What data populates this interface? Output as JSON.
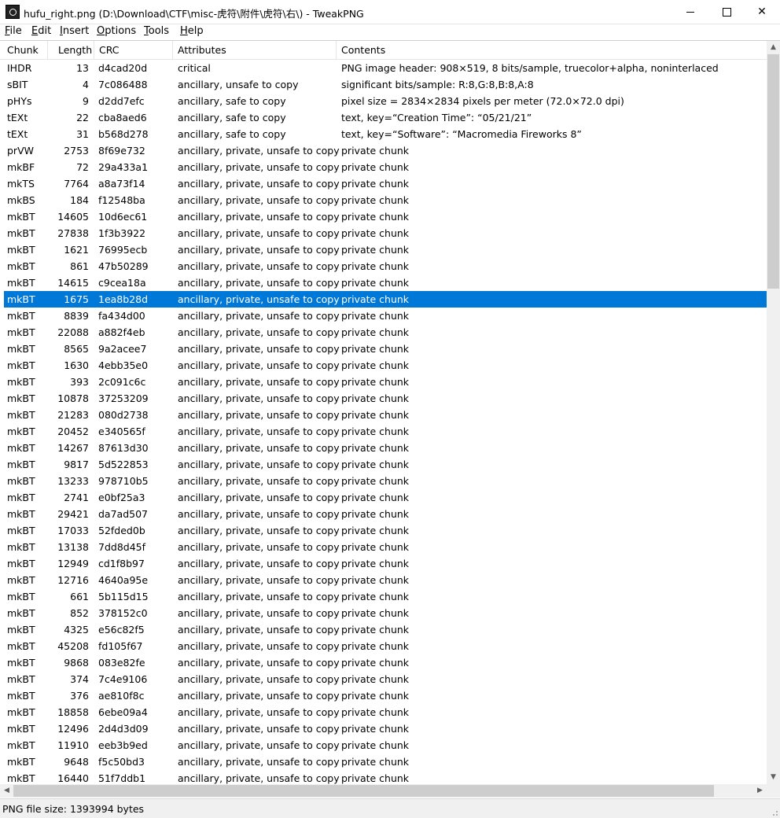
{
  "window": {
    "title": "hufu_right.png (D:\\Download\\CTF\\misc-虎符\\附件\\虎符\\右\\) - TweakPNG"
  },
  "menu": [
    {
      "key": "F",
      "rest": "ile"
    },
    {
      "key": "E",
      "rest": "dit"
    },
    {
      "key": "I",
      "rest": "nsert"
    },
    {
      "key": "O",
      "rest": "ptions"
    },
    {
      "key": "T",
      "rest": "ools"
    },
    {
      "key": "H",
      "rest": "elp"
    }
  ],
  "columns": [
    "Chunk",
    "Length",
    "CRC",
    "Attributes",
    "Contents"
  ],
  "rows": [
    {
      "chunk": "IHDR",
      "length": "13",
      "crc": "d4cad20d",
      "attributes": "critical",
      "contents": "PNG image header: 908×519, 8 bits/sample, truecolor+alpha, noninterlaced"
    },
    {
      "chunk": "sBIT",
      "length": "4",
      "crc": "7c086488",
      "attributes": "ancillary, unsafe to copy",
      "contents": "significant bits/sample: R:8,G:8,B:8,A:8"
    },
    {
      "chunk": "pHYs",
      "length": "9",
      "crc": "d2dd7efc",
      "attributes": "ancillary, safe to copy",
      "contents": "pixel size = 2834×2834 pixels per meter (72.0×72.0 dpi)"
    },
    {
      "chunk": "tEXt",
      "length": "22",
      "crc": "cba8aed6",
      "attributes": "ancillary, safe to copy",
      "contents": "text, key=“Creation Time”: “05/21/21”"
    },
    {
      "chunk": "tEXt",
      "length": "31",
      "crc": "b568d278",
      "attributes": "ancillary, safe to copy",
      "contents": "text, key=“Software”: “Macromedia Fireworks 8”"
    },
    {
      "chunk": "prVW",
      "length": "2753",
      "crc": "8f69e732",
      "attributes": "ancillary, private, unsafe to copy",
      "contents": "private chunk"
    },
    {
      "chunk": "mkBF",
      "length": "72",
      "crc": "29a433a1",
      "attributes": "ancillary, private, unsafe to copy",
      "contents": "private chunk"
    },
    {
      "chunk": "mkTS",
      "length": "7764",
      "crc": "a8a73f14",
      "attributes": "ancillary, private, unsafe to copy",
      "contents": "private chunk"
    },
    {
      "chunk": "mkBS",
      "length": "184",
      "crc": "f12548ba",
      "attributes": "ancillary, private, unsafe to copy",
      "contents": "private chunk"
    },
    {
      "chunk": "mkBT",
      "length": "14605",
      "crc": "10d6ec61",
      "attributes": "ancillary, private, unsafe to copy",
      "contents": "private chunk"
    },
    {
      "chunk": "mkBT",
      "length": "27838",
      "crc": "1f3b3922",
      "attributes": "ancillary, private, unsafe to copy",
      "contents": "private chunk"
    },
    {
      "chunk": "mkBT",
      "length": "1621",
      "crc": "76995ecb",
      "attributes": "ancillary, private, unsafe to copy",
      "contents": "private chunk"
    },
    {
      "chunk": "mkBT",
      "length": "861",
      "crc": "47b50289",
      "attributes": "ancillary, private, unsafe to copy",
      "contents": "private chunk"
    },
    {
      "chunk": "mkBT",
      "length": "14615",
      "crc": "c9cea18a",
      "attributes": "ancillary, private, unsafe to copy",
      "contents": "private chunk"
    },
    {
      "chunk": "mkBT",
      "length": "1675",
      "crc": "1ea8b28d",
      "attributes": "ancillary, private, unsafe to copy",
      "contents": "private chunk",
      "selected": true
    },
    {
      "chunk": "mkBT",
      "length": "8839",
      "crc": "fa434d00",
      "attributes": "ancillary, private, unsafe to copy",
      "contents": "private chunk"
    },
    {
      "chunk": "mkBT",
      "length": "22088",
      "crc": "a882f4eb",
      "attributes": "ancillary, private, unsafe to copy",
      "contents": "private chunk"
    },
    {
      "chunk": "mkBT",
      "length": "8565",
      "crc": "9a2acee7",
      "attributes": "ancillary, private, unsafe to copy",
      "contents": "private chunk"
    },
    {
      "chunk": "mkBT",
      "length": "1630",
      "crc": "4ebb35e0",
      "attributes": "ancillary, private, unsafe to copy",
      "contents": "private chunk"
    },
    {
      "chunk": "mkBT",
      "length": "393",
      "crc": "2c091c6c",
      "attributes": "ancillary, private, unsafe to copy",
      "contents": "private chunk"
    },
    {
      "chunk": "mkBT",
      "length": "10878",
      "crc": "37253209",
      "attributes": "ancillary, private, unsafe to copy",
      "contents": "private chunk"
    },
    {
      "chunk": "mkBT",
      "length": "21283",
      "crc": "080d2738",
      "attributes": "ancillary, private, unsafe to copy",
      "contents": "private chunk"
    },
    {
      "chunk": "mkBT",
      "length": "20452",
      "crc": "e340565f",
      "attributes": "ancillary, private, unsafe to copy",
      "contents": "private chunk"
    },
    {
      "chunk": "mkBT",
      "length": "14267",
      "crc": "87613d30",
      "attributes": "ancillary, private, unsafe to copy",
      "contents": "private chunk"
    },
    {
      "chunk": "mkBT",
      "length": "9817",
      "crc": "5d522853",
      "attributes": "ancillary, private, unsafe to copy",
      "contents": "private chunk"
    },
    {
      "chunk": "mkBT",
      "length": "13233",
      "crc": "978710b5",
      "attributes": "ancillary, private, unsafe to copy",
      "contents": "private chunk"
    },
    {
      "chunk": "mkBT",
      "length": "2741",
      "crc": "e0bf25a3",
      "attributes": "ancillary, private, unsafe to copy",
      "contents": "private chunk"
    },
    {
      "chunk": "mkBT",
      "length": "29421",
      "crc": "da7ad507",
      "attributes": "ancillary, private, unsafe to copy",
      "contents": "private chunk"
    },
    {
      "chunk": "mkBT",
      "length": "17033",
      "crc": "52fded0b",
      "attributes": "ancillary, private, unsafe to copy",
      "contents": "private chunk"
    },
    {
      "chunk": "mkBT",
      "length": "13138",
      "crc": "7dd8d45f",
      "attributes": "ancillary, private, unsafe to copy",
      "contents": "private chunk"
    },
    {
      "chunk": "mkBT",
      "length": "12949",
      "crc": "cd1f8b97",
      "attributes": "ancillary, private, unsafe to copy",
      "contents": "private chunk"
    },
    {
      "chunk": "mkBT",
      "length": "12716",
      "crc": "4640a95e",
      "attributes": "ancillary, private, unsafe to copy",
      "contents": "private chunk"
    },
    {
      "chunk": "mkBT",
      "length": "661",
      "crc": "5b115d15",
      "attributes": "ancillary, private, unsafe to copy",
      "contents": "private chunk"
    },
    {
      "chunk": "mkBT",
      "length": "852",
      "crc": "378152c0",
      "attributes": "ancillary, private, unsafe to copy",
      "contents": "private chunk"
    },
    {
      "chunk": "mkBT",
      "length": "4325",
      "crc": "e56c82f5",
      "attributes": "ancillary, private, unsafe to copy",
      "contents": "private chunk"
    },
    {
      "chunk": "mkBT",
      "length": "45208",
      "crc": "fd105f67",
      "attributes": "ancillary, private, unsafe to copy",
      "contents": "private chunk"
    },
    {
      "chunk": "mkBT",
      "length": "9868",
      "crc": "083e82fe",
      "attributes": "ancillary, private, unsafe to copy",
      "contents": "private chunk"
    },
    {
      "chunk": "mkBT",
      "length": "374",
      "crc": "7c4e9106",
      "attributes": "ancillary, private, unsafe to copy",
      "contents": "private chunk"
    },
    {
      "chunk": "mkBT",
      "length": "376",
      "crc": "ae810f8c",
      "attributes": "ancillary, private, unsafe to copy",
      "contents": "private chunk"
    },
    {
      "chunk": "mkBT",
      "length": "18858",
      "crc": "6ebe09a4",
      "attributes": "ancillary, private, unsafe to copy",
      "contents": "private chunk"
    },
    {
      "chunk": "mkBT",
      "length": "12496",
      "crc": "2d4d3d09",
      "attributes": "ancillary, private, unsafe to copy",
      "contents": "private chunk"
    },
    {
      "chunk": "mkBT",
      "length": "11910",
      "crc": "eeb3b9ed",
      "attributes": "ancillary, private, unsafe to copy",
      "contents": "private chunk"
    },
    {
      "chunk": "mkBT",
      "length": "9648",
      "crc": "f5c50bd3",
      "attributes": "ancillary, private, unsafe to copy",
      "contents": "private chunk"
    },
    {
      "chunk": "mkBT",
      "length": "16440",
      "crc": "51f7ddb1",
      "attributes": "ancillary, private, unsafe to copy",
      "contents": "private chunk"
    }
  ],
  "status": {
    "text": "PNG file size: 1393994 bytes"
  },
  "colors": {
    "selection": "#0078d7",
    "chrome": "#f0f0f0"
  }
}
